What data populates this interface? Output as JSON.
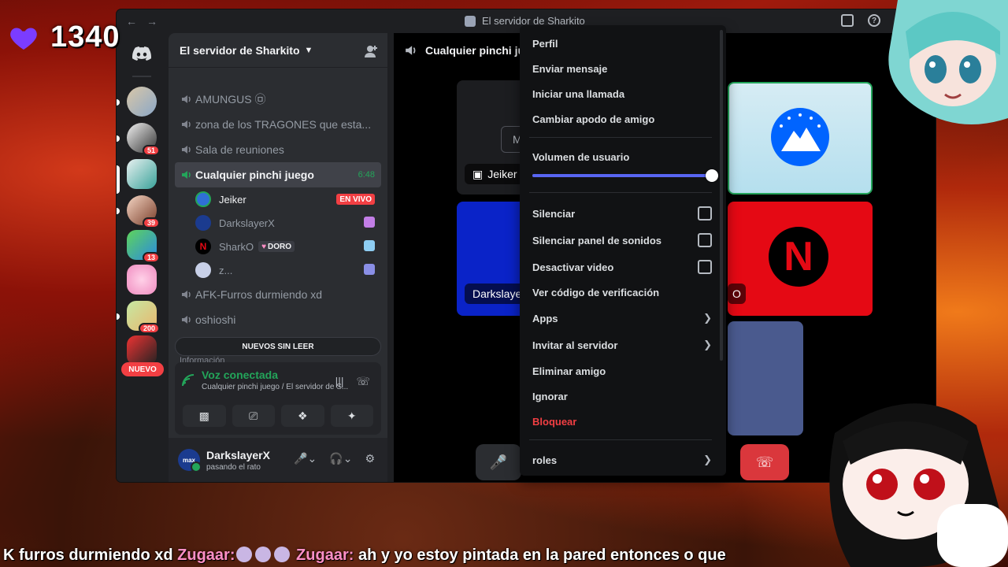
{
  "overlay": {
    "likes_count": "1340",
    "ticker": {
      "prefix": "K furros durmiendo xd",
      "user1": "Zugaar:",
      "user2": "Zugaar:",
      "message": "ah y yo estoy pintada en la pared entonces o que"
    }
  },
  "window": {
    "title": "El servidor de Sharkito"
  },
  "guilds": {
    "badges": [
      "51",
      "39",
      "13",
      "200"
    ],
    "new_label": "NUEVO"
  },
  "server": {
    "name": "El servidor de Sharkito",
    "channels": [
      {
        "name": "AMUNGUS ㉤"
      },
      {
        "name": "zona de los TRAGONES que esta..."
      },
      {
        "name": "Sala de reuniones"
      },
      {
        "name": "Cualquier pinchi juego",
        "timer": "6:48"
      }
    ],
    "voice_users": [
      {
        "name": "Jeiker",
        "live": "EN VIVO"
      },
      {
        "name": "DarkslayerX"
      },
      {
        "name": "SharkO",
        "tag": "DORO"
      },
      {
        "name": "z..."
      }
    ],
    "more_channels": [
      {
        "name": "AFK-Furros durmiendo xd"
      },
      {
        "name": "oshioshi"
      }
    ],
    "unread_label": "NUEVOS SIN LEER",
    "info_label": "Información"
  },
  "voice_panel": {
    "title": "Voz conectada",
    "subtitle": "Cualquier pinchi juego / El servidor de S..."
  },
  "user": {
    "name": "DarkslayerX",
    "status": "pasando el rato",
    "avatar_text": "max"
  },
  "stage": {
    "channel_name": "Cualquier pinchi ju",
    "tile_labels": [
      "Jeiker",
      "Darkslaye",
      "O"
    ],
    "tile_partial": "M"
  },
  "context_menu": {
    "profile": "Perfil",
    "send_message": "Enviar mensaje",
    "start_call": "Iniciar una llamada",
    "change_nickname": "Cambiar apodo de amigo",
    "volume_label": "Volumen de usuario",
    "volume_value": 1.0,
    "mute": "Silenciar",
    "mute_soundboard": "Silenciar panel de sonidos",
    "disable_video": "Desactivar video",
    "verification": "Ver código de verificación",
    "apps": "Apps",
    "invite": "Invitar al servidor",
    "remove_friend": "Eliminar amigo",
    "ignore": "Ignorar",
    "block": "Bloquear",
    "roles": "roles"
  },
  "colors": {
    "accent": "#5865f2",
    "online": "#23a55a",
    "danger": "#f23f43",
    "likes_heart": "#7b3cff"
  }
}
